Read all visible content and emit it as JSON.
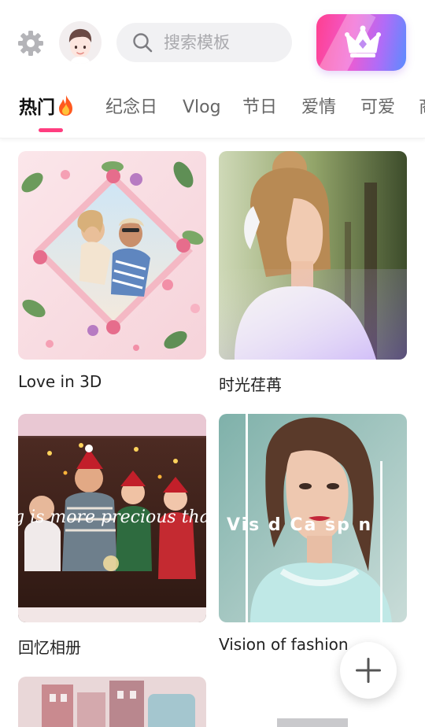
{
  "header": {
    "search_placeholder": "搜索模板"
  },
  "tabs": [
    {
      "label": "热门",
      "active": true
    },
    {
      "label": "纪念日"
    },
    {
      "label": "Vlog"
    },
    {
      "label": "节日"
    },
    {
      "label": "爱情"
    },
    {
      "label": "可爱"
    },
    {
      "label": "商"
    }
  ],
  "templates": [
    {
      "title": "Love in 3D"
    },
    {
      "title": "时光荏苒"
    },
    {
      "title": "回忆相册",
      "overlay_text": "g is more precious than"
    },
    {
      "title": "Vision of  fashion",
      "overlay_text": "Vis  d   Ca  sp  n"
    }
  ],
  "colors": {
    "accent": "#ff3d7f",
    "vip_gradient_start": "#ff3f8f",
    "vip_gradient_end": "#5a8cff"
  },
  "icons": {
    "settings": "gear-icon",
    "search": "search-icon",
    "vip": "crown-icon",
    "add": "plus-icon",
    "hot": "fire-icon"
  }
}
